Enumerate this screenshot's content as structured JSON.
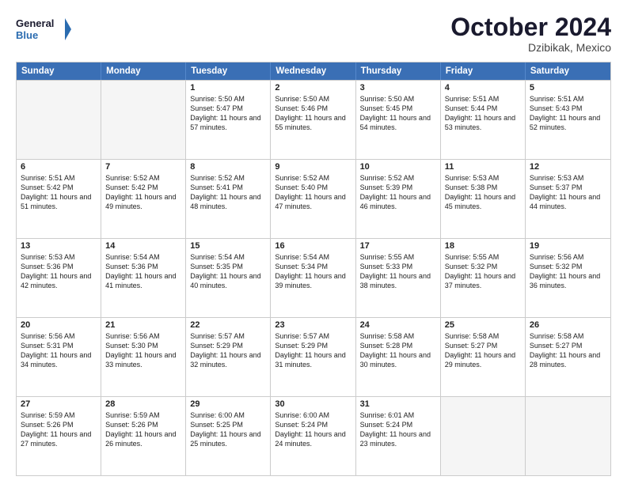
{
  "logo": {
    "line1": "General",
    "line2": "Blue"
  },
  "title": "October 2024",
  "location": "Dzibikak, Mexico",
  "header_days": [
    "Sunday",
    "Monday",
    "Tuesday",
    "Wednesday",
    "Thursday",
    "Friday",
    "Saturday"
  ],
  "rows": [
    [
      {
        "day": "",
        "empty": true,
        "text": ""
      },
      {
        "day": "",
        "empty": true,
        "text": ""
      },
      {
        "day": "1",
        "empty": false,
        "text": "Sunrise: 5:50 AM\nSunset: 5:47 PM\nDaylight: 11 hours and 57 minutes."
      },
      {
        "day": "2",
        "empty": false,
        "text": "Sunrise: 5:50 AM\nSunset: 5:46 PM\nDaylight: 11 hours and 55 minutes."
      },
      {
        "day": "3",
        "empty": false,
        "text": "Sunrise: 5:50 AM\nSunset: 5:45 PM\nDaylight: 11 hours and 54 minutes."
      },
      {
        "day": "4",
        "empty": false,
        "text": "Sunrise: 5:51 AM\nSunset: 5:44 PM\nDaylight: 11 hours and 53 minutes."
      },
      {
        "day": "5",
        "empty": false,
        "text": "Sunrise: 5:51 AM\nSunset: 5:43 PM\nDaylight: 11 hours and 52 minutes."
      }
    ],
    [
      {
        "day": "6",
        "empty": false,
        "text": "Sunrise: 5:51 AM\nSunset: 5:42 PM\nDaylight: 11 hours and 51 minutes."
      },
      {
        "day": "7",
        "empty": false,
        "text": "Sunrise: 5:52 AM\nSunset: 5:42 PM\nDaylight: 11 hours and 49 minutes."
      },
      {
        "day": "8",
        "empty": false,
        "text": "Sunrise: 5:52 AM\nSunset: 5:41 PM\nDaylight: 11 hours and 48 minutes."
      },
      {
        "day": "9",
        "empty": false,
        "text": "Sunrise: 5:52 AM\nSunset: 5:40 PM\nDaylight: 11 hours and 47 minutes."
      },
      {
        "day": "10",
        "empty": false,
        "text": "Sunrise: 5:52 AM\nSunset: 5:39 PM\nDaylight: 11 hours and 46 minutes."
      },
      {
        "day": "11",
        "empty": false,
        "text": "Sunrise: 5:53 AM\nSunset: 5:38 PM\nDaylight: 11 hours and 45 minutes."
      },
      {
        "day": "12",
        "empty": false,
        "text": "Sunrise: 5:53 AM\nSunset: 5:37 PM\nDaylight: 11 hours and 44 minutes."
      }
    ],
    [
      {
        "day": "13",
        "empty": false,
        "text": "Sunrise: 5:53 AM\nSunset: 5:36 PM\nDaylight: 11 hours and 42 minutes."
      },
      {
        "day": "14",
        "empty": false,
        "text": "Sunrise: 5:54 AM\nSunset: 5:36 PM\nDaylight: 11 hours and 41 minutes."
      },
      {
        "day": "15",
        "empty": false,
        "text": "Sunrise: 5:54 AM\nSunset: 5:35 PM\nDaylight: 11 hours and 40 minutes."
      },
      {
        "day": "16",
        "empty": false,
        "text": "Sunrise: 5:54 AM\nSunset: 5:34 PM\nDaylight: 11 hours and 39 minutes."
      },
      {
        "day": "17",
        "empty": false,
        "text": "Sunrise: 5:55 AM\nSunset: 5:33 PM\nDaylight: 11 hours and 38 minutes."
      },
      {
        "day": "18",
        "empty": false,
        "text": "Sunrise: 5:55 AM\nSunset: 5:32 PM\nDaylight: 11 hours and 37 minutes."
      },
      {
        "day": "19",
        "empty": false,
        "text": "Sunrise: 5:56 AM\nSunset: 5:32 PM\nDaylight: 11 hours and 36 minutes."
      }
    ],
    [
      {
        "day": "20",
        "empty": false,
        "text": "Sunrise: 5:56 AM\nSunset: 5:31 PM\nDaylight: 11 hours and 34 minutes."
      },
      {
        "day": "21",
        "empty": false,
        "text": "Sunrise: 5:56 AM\nSunset: 5:30 PM\nDaylight: 11 hours and 33 minutes."
      },
      {
        "day": "22",
        "empty": false,
        "text": "Sunrise: 5:57 AM\nSunset: 5:29 PM\nDaylight: 11 hours and 32 minutes."
      },
      {
        "day": "23",
        "empty": false,
        "text": "Sunrise: 5:57 AM\nSunset: 5:29 PM\nDaylight: 11 hours and 31 minutes."
      },
      {
        "day": "24",
        "empty": false,
        "text": "Sunrise: 5:58 AM\nSunset: 5:28 PM\nDaylight: 11 hours and 30 minutes."
      },
      {
        "day": "25",
        "empty": false,
        "text": "Sunrise: 5:58 AM\nSunset: 5:27 PM\nDaylight: 11 hours and 29 minutes."
      },
      {
        "day": "26",
        "empty": false,
        "text": "Sunrise: 5:58 AM\nSunset: 5:27 PM\nDaylight: 11 hours and 28 minutes."
      }
    ],
    [
      {
        "day": "27",
        "empty": false,
        "text": "Sunrise: 5:59 AM\nSunset: 5:26 PM\nDaylight: 11 hours and 27 minutes."
      },
      {
        "day": "28",
        "empty": false,
        "text": "Sunrise: 5:59 AM\nSunset: 5:26 PM\nDaylight: 11 hours and 26 minutes."
      },
      {
        "day": "29",
        "empty": false,
        "text": "Sunrise: 6:00 AM\nSunset: 5:25 PM\nDaylight: 11 hours and 25 minutes."
      },
      {
        "day": "30",
        "empty": false,
        "text": "Sunrise: 6:00 AM\nSunset: 5:24 PM\nDaylight: 11 hours and 24 minutes."
      },
      {
        "day": "31",
        "empty": false,
        "text": "Sunrise: 6:01 AM\nSunset: 5:24 PM\nDaylight: 11 hours and 23 minutes."
      },
      {
        "day": "",
        "empty": true,
        "text": ""
      },
      {
        "day": "",
        "empty": true,
        "text": ""
      }
    ]
  ]
}
